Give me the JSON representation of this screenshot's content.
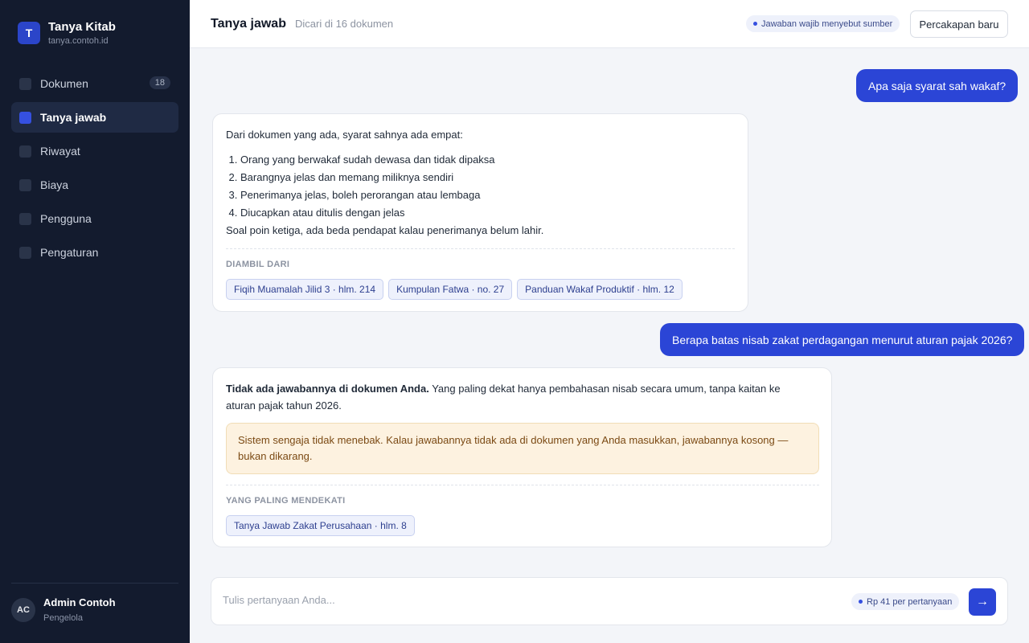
{
  "sidebar": {
    "brand": {
      "logo_letter": "T",
      "title": "Tanya Kitab",
      "domain": "tanya.contoh.id"
    },
    "items": [
      {
        "label": "Dokumen",
        "count": "18"
      },
      {
        "label": "Tanya jawab"
      },
      {
        "label": "Riwayat"
      },
      {
        "label": "Biaya"
      },
      {
        "label": "Pengguna"
      },
      {
        "label": "Pengaturan"
      }
    ],
    "active_item": "Tanya jawab",
    "user": {
      "initials": "AC",
      "name": "Admin Contoh",
      "role": "Pengelola"
    }
  },
  "header": {
    "title": "Tanya jawab",
    "subtitle": "Dicari di 16 dokumen",
    "badge": "Jawaban wajib menyebut sumber",
    "new_chat_label": "Percakapan baru"
  },
  "conversation": [
    {
      "question": "Apa saja syarat sah wakaf?",
      "answer": {
        "intro": "Dari dokumen yang ada, syarat sahnya ada empat:",
        "list": [
          "Orang yang berwakaf sudah dewasa dan tidak dipaksa",
          "Barangnya jelas dan memang miliknya sendiri",
          "Penerimanya jelas, boleh perorangan atau lembaga",
          "Diucapkan atau ditulis dengan jelas"
        ],
        "note": "Soal poin ketiga, ada beda pendapat kalau penerimanya belum lahir.",
        "sources_label": "DIAMBIL DARI",
        "sources": [
          "Fiqih Muamalah Jilid 3 · hlm. 214",
          "Kumpulan Fatwa · no. 27",
          "Panduan Wakaf Produktif · hlm. 12"
        ]
      }
    },
    {
      "question": "Berapa batas nisab zakat perdagangan menurut aturan pajak 2026?",
      "answer": {
        "lead_bold": "Tidak ada jawabannya di dokumen Anda.",
        "lead_rest": " Yang paling dekat hanya pembahasan nisab secara umum, tanpa kaitan ke aturan pajak tahun 2026.",
        "notice": "Sistem sengaja tidak menebak. Kalau jawabannya tidak ada di dokumen yang Anda masukkan, jawabannya kosong — bukan dikarang.",
        "sources_label": "YANG PALING MENDEKATI",
        "sources": [
          "Tanya Jawab Zakat Perusahaan · hlm. 8"
        ]
      }
    }
  ],
  "composer": {
    "placeholder": "Tulis pertanyaan Anda...",
    "cost": "Rp 41 per pertanyaan",
    "send_icon": "→"
  },
  "colors": {
    "accent": "#2b45d6",
    "sidebar_bg": "#131b2e",
    "notice_bg": "#fdf2e0"
  }
}
